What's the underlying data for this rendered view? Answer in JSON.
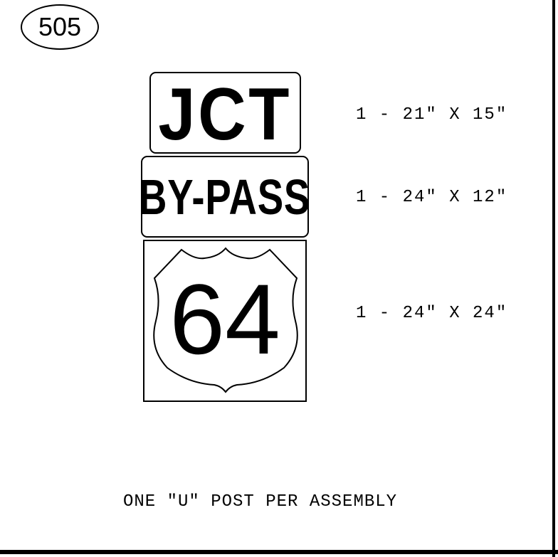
{
  "sheet_number": "505",
  "signs": {
    "jct": {
      "text": "JCT",
      "size": "1 - 21″ X 15″"
    },
    "bypass": {
      "text": "BY-PASS",
      "size": "1 - 24″ X 12″"
    },
    "route": {
      "number": "64",
      "shield": "us-route-shield-icon",
      "size": "1 - 24″ X 24″"
    }
  },
  "note": "ONE ″U″ POST PER ASSEMBLY"
}
